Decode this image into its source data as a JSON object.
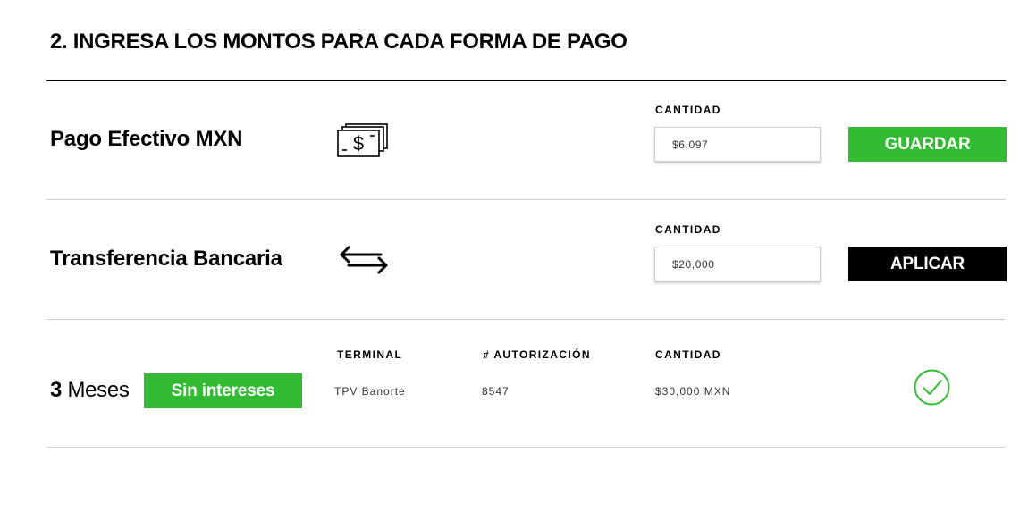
{
  "section_title": "2. INGRESA LOS MONTOS PARA CADA FORMA DE PAGO",
  "rows": {
    "cash": {
      "title": "Pago Efectivo MXN",
      "icon": "cash-icon",
      "field_label": "CANTIDAD",
      "amount": "$6,097",
      "button_label": "GUARDAR",
      "button_color": "#33bb33"
    },
    "transfer": {
      "title": "Transferencia Bancaria",
      "icon": "transfer-arrows-icon",
      "field_label": "CANTIDAD",
      "amount": "$20,000",
      "button_label": "APLICAR",
      "button_color": "#000000"
    },
    "card": {
      "months_number": "3",
      "months_word": "Meses",
      "badge_label": "Sin intereses",
      "badge_color": "#33bb33",
      "columns": [
        "TERMINAL",
        "# AUTORIZACIÓN",
        "CANTIDAD"
      ],
      "terminal": "TPV Banorte",
      "authorization": "8547",
      "amount": "$30,000 MXN",
      "status_icon": "check-circle-icon"
    }
  },
  "colors": {
    "accent_green": "#33bb33",
    "text": "#000000",
    "divider": "#cfcfcf"
  }
}
